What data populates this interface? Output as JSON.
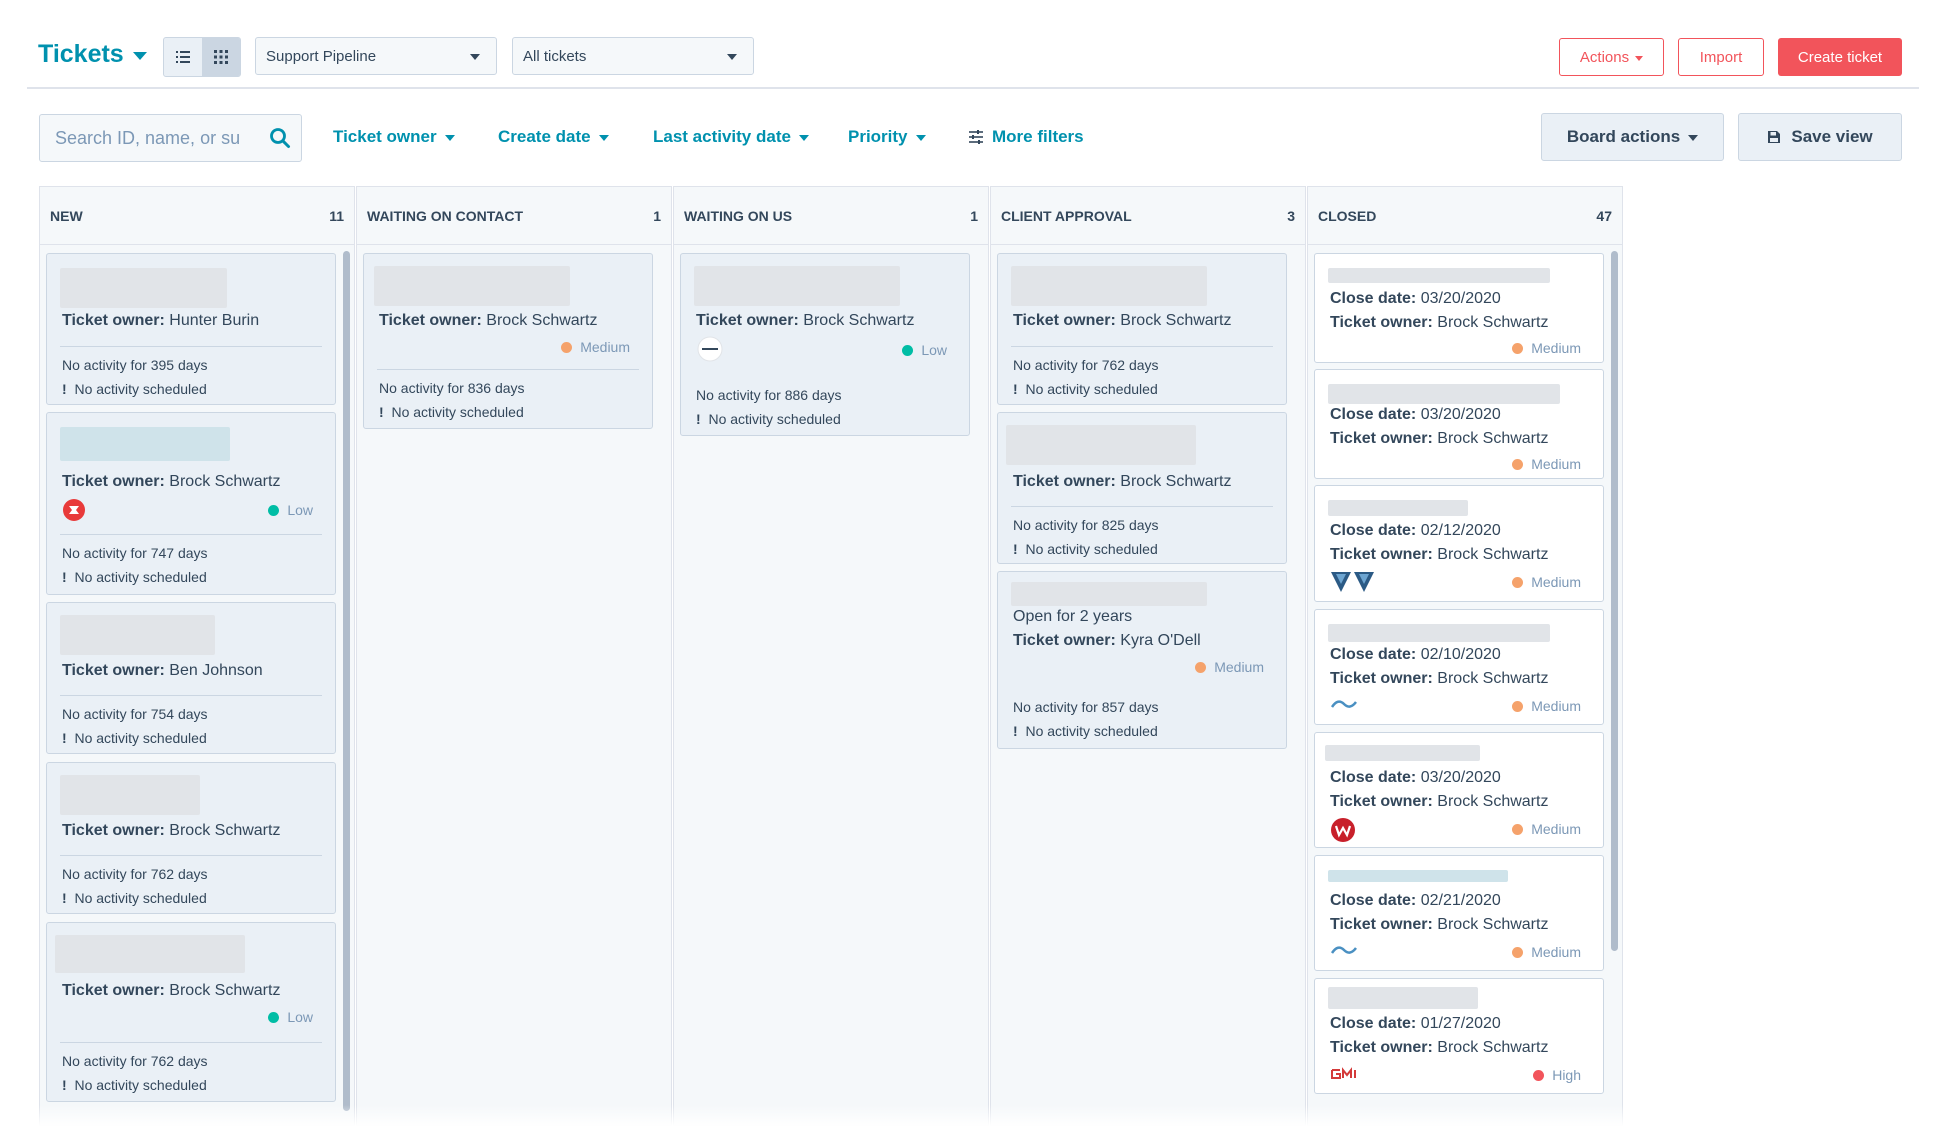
{
  "header": {
    "title": "Tickets",
    "pipeline_select": "Support Pipeline",
    "view_select": "All tickets",
    "actions_label": "Actions",
    "import_label": "Import",
    "create_label": "Create ticket"
  },
  "filters": {
    "search_placeholder": "Search ID, name, or su",
    "ticket_owner": "Ticket owner",
    "create_date": "Create date",
    "last_activity": "Last activity date",
    "priority": "Priority",
    "more_filters": "More filters",
    "board_actions": "Board actions",
    "save_view": "Save view"
  },
  "colors": {
    "accent": "#0091ae",
    "brand": "#f2545b",
    "low": "#00bda5",
    "medium": "#f5a26b",
    "high": "#f2545b"
  },
  "columns": [
    {
      "title": "NEW",
      "count": "11"
    },
    {
      "title": "WAITING ON CONTACT",
      "count": "1"
    },
    {
      "title": "WAITING ON US",
      "count": "1"
    },
    {
      "title": "CLIENT APPROVAL",
      "count": "3"
    },
    {
      "title": "CLOSED",
      "count": "47"
    }
  ],
  "labels": {
    "owner": "Ticket owner:",
    "close": "Close date:",
    "no_scheduled": "No activity scheduled",
    "bang": "!"
  },
  "new_cards": [
    {
      "owner": "Hunter Burin",
      "activity": "No activity for 395 days"
    },
    {
      "owner": "Brock Schwartz",
      "priority": "Low",
      "activity": "No activity for 747 days"
    },
    {
      "owner": "Ben Johnson",
      "activity": "No activity for 754 days"
    },
    {
      "owner": "Brock Schwartz",
      "activity": "No activity for 762 days"
    },
    {
      "owner": "Brock Schwartz",
      "priority": "Low",
      "activity": "No activity for 762 days"
    }
  ],
  "waiting_contact_cards": [
    {
      "owner": "Brock Schwartz",
      "priority": "Medium",
      "activity": "No activity for 836 days"
    }
  ],
  "waiting_us_cards": [
    {
      "owner": "Brock Schwartz",
      "priority": "Low",
      "activity": "No activity for 886 days"
    }
  ],
  "client_approval_cards": [
    {
      "owner": "Brock Schwartz",
      "activity": "No activity for 762 days"
    },
    {
      "owner": "Brock Schwartz",
      "activity": "No activity for 825 days"
    },
    {
      "open_for": "Open for 2 years",
      "owner": "Kyra O'Dell",
      "priority": "Medium",
      "activity": "No activity for 857 days"
    }
  ],
  "closed_cards": [
    {
      "close_date": "03/20/2020",
      "owner": "Brock Schwartz",
      "priority": "Medium"
    },
    {
      "close_date": "03/20/2020",
      "owner": "Brock Schwartz",
      "priority": "Medium"
    },
    {
      "close_date": "02/12/2020",
      "owner": "Brock Schwartz",
      "priority": "Medium"
    },
    {
      "close_date": "02/10/2020",
      "owner": "Brock Schwartz",
      "priority": "Medium"
    },
    {
      "close_date": "03/20/2020",
      "owner": "Brock Schwartz",
      "priority": "Medium"
    },
    {
      "close_date": "02/21/2020",
      "owner": "Brock Schwartz",
      "priority": "Medium"
    },
    {
      "close_date": "01/27/2020",
      "owner": "Brock Schwartz",
      "priority": "High"
    }
  ]
}
